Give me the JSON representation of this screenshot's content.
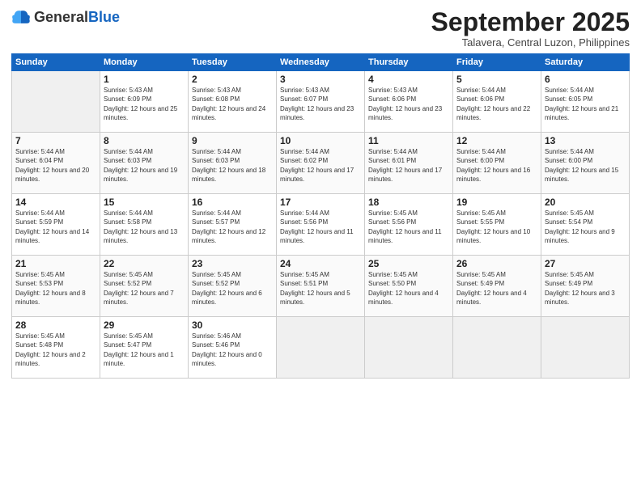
{
  "header": {
    "logo_general": "General",
    "logo_blue": "Blue",
    "month_title": "September 2025",
    "subtitle": "Talavera, Central Luzon, Philippines"
  },
  "days_of_week": [
    "Sunday",
    "Monday",
    "Tuesday",
    "Wednesday",
    "Thursday",
    "Friday",
    "Saturday"
  ],
  "weeks": [
    [
      {
        "day": "",
        "sunrise": "",
        "sunset": "",
        "daylight": ""
      },
      {
        "day": "1",
        "sunrise": "Sunrise: 5:43 AM",
        "sunset": "Sunset: 6:09 PM",
        "daylight": "Daylight: 12 hours and 25 minutes."
      },
      {
        "day": "2",
        "sunrise": "Sunrise: 5:43 AM",
        "sunset": "Sunset: 6:08 PM",
        "daylight": "Daylight: 12 hours and 24 minutes."
      },
      {
        "day": "3",
        "sunrise": "Sunrise: 5:43 AM",
        "sunset": "Sunset: 6:07 PM",
        "daylight": "Daylight: 12 hours and 23 minutes."
      },
      {
        "day": "4",
        "sunrise": "Sunrise: 5:43 AM",
        "sunset": "Sunset: 6:06 PM",
        "daylight": "Daylight: 12 hours and 23 minutes."
      },
      {
        "day": "5",
        "sunrise": "Sunrise: 5:44 AM",
        "sunset": "Sunset: 6:06 PM",
        "daylight": "Daylight: 12 hours and 22 minutes."
      },
      {
        "day": "6",
        "sunrise": "Sunrise: 5:44 AM",
        "sunset": "Sunset: 6:05 PM",
        "daylight": "Daylight: 12 hours and 21 minutes."
      }
    ],
    [
      {
        "day": "7",
        "sunrise": "Sunrise: 5:44 AM",
        "sunset": "Sunset: 6:04 PM",
        "daylight": "Daylight: 12 hours and 20 minutes."
      },
      {
        "day": "8",
        "sunrise": "Sunrise: 5:44 AM",
        "sunset": "Sunset: 6:03 PM",
        "daylight": "Daylight: 12 hours and 19 minutes."
      },
      {
        "day": "9",
        "sunrise": "Sunrise: 5:44 AM",
        "sunset": "Sunset: 6:03 PM",
        "daylight": "Daylight: 12 hours and 18 minutes."
      },
      {
        "day": "10",
        "sunrise": "Sunrise: 5:44 AM",
        "sunset": "Sunset: 6:02 PM",
        "daylight": "Daylight: 12 hours and 17 minutes."
      },
      {
        "day": "11",
        "sunrise": "Sunrise: 5:44 AM",
        "sunset": "Sunset: 6:01 PM",
        "daylight": "Daylight: 12 hours and 17 minutes."
      },
      {
        "day": "12",
        "sunrise": "Sunrise: 5:44 AM",
        "sunset": "Sunset: 6:00 PM",
        "daylight": "Daylight: 12 hours and 16 minutes."
      },
      {
        "day": "13",
        "sunrise": "Sunrise: 5:44 AM",
        "sunset": "Sunset: 6:00 PM",
        "daylight": "Daylight: 12 hours and 15 minutes."
      }
    ],
    [
      {
        "day": "14",
        "sunrise": "Sunrise: 5:44 AM",
        "sunset": "Sunset: 5:59 PM",
        "daylight": "Daylight: 12 hours and 14 minutes."
      },
      {
        "day": "15",
        "sunrise": "Sunrise: 5:44 AM",
        "sunset": "Sunset: 5:58 PM",
        "daylight": "Daylight: 12 hours and 13 minutes."
      },
      {
        "day": "16",
        "sunrise": "Sunrise: 5:44 AM",
        "sunset": "Sunset: 5:57 PM",
        "daylight": "Daylight: 12 hours and 12 minutes."
      },
      {
        "day": "17",
        "sunrise": "Sunrise: 5:44 AM",
        "sunset": "Sunset: 5:56 PM",
        "daylight": "Daylight: 12 hours and 11 minutes."
      },
      {
        "day": "18",
        "sunrise": "Sunrise: 5:45 AM",
        "sunset": "Sunset: 5:56 PM",
        "daylight": "Daylight: 12 hours and 11 minutes."
      },
      {
        "day": "19",
        "sunrise": "Sunrise: 5:45 AM",
        "sunset": "Sunset: 5:55 PM",
        "daylight": "Daylight: 12 hours and 10 minutes."
      },
      {
        "day": "20",
        "sunrise": "Sunrise: 5:45 AM",
        "sunset": "Sunset: 5:54 PM",
        "daylight": "Daylight: 12 hours and 9 minutes."
      }
    ],
    [
      {
        "day": "21",
        "sunrise": "Sunrise: 5:45 AM",
        "sunset": "Sunset: 5:53 PM",
        "daylight": "Daylight: 12 hours and 8 minutes."
      },
      {
        "day": "22",
        "sunrise": "Sunrise: 5:45 AM",
        "sunset": "Sunset: 5:52 PM",
        "daylight": "Daylight: 12 hours and 7 minutes."
      },
      {
        "day": "23",
        "sunrise": "Sunrise: 5:45 AM",
        "sunset": "Sunset: 5:52 PM",
        "daylight": "Daylight: 12 hours and 6 minutes."
      },
      {
        "day": "24",
        "sunrise": "Sunrise: 5:45 AM",
        "sunset": "Sunset: 5:51 PM",
        "daylight": "Daylight: 12 hours and 5 minutes."
      },
      {
        "day": "25",
        "sunrise": "Sunrise: 5:45 AM",
        "sunset": "Sunset: 5:50 PM",
        "daylight": "Daylight: 12 hours and 4 minutes."
      },
      {
        "day": "26",
        "sunrise": "Sunrise: 5:45 AM",
        "sunset": "Sunset: 5:49 PM",
        "daylight": "Daylight: 12 hours and 4 minutes."
      },
      {
        "day": "27",
        "sunrise": "Sunrise: 5:45 AM",
        "sunset": "Sunset: 5:49 PM",
        "daylight": "Daylight: 12 hours and 3 minutes."
      }
    ],
    [
      {
        "day": "28",
        "sunrise": "Sunrise: 5:45 AM",
        "sunset": "Sunset: 5:48 PM",
        "daylight": "Daylight: 12 hours and 2 minutes."
      },
      {
        "day": "29",
        "sunrise": "Sunrise: 5:45 AM",
        "sunset": "Sunset: 5:47 PM",
        "daylight": "Daylight: 12 hours and 1 minute."
      },
      {
        "day": "30",
        "sunrise": "Sunrise: 5:46 AM",
        "sunset": "Sunset: 5:46 PM",
        "daylight": "Daylight: 12 hours and 0 minutes."
      },
      {
        "day": "",
        "sunrise": "",
        "sunset": "",
        "daylight": ""
      },
      {
        "day": "",
        "sunrise": "",
        "sunset": "",
        "daylight": ""
      },
      {
        "day": "",
        "sunrise": "",
        "sunset": "",
        "daylight": ""
      },
      {
        "day": "",
        "sunrise": "",
        "sunset": "",
        "daylight": ""
      }
    ]
  ]
}
